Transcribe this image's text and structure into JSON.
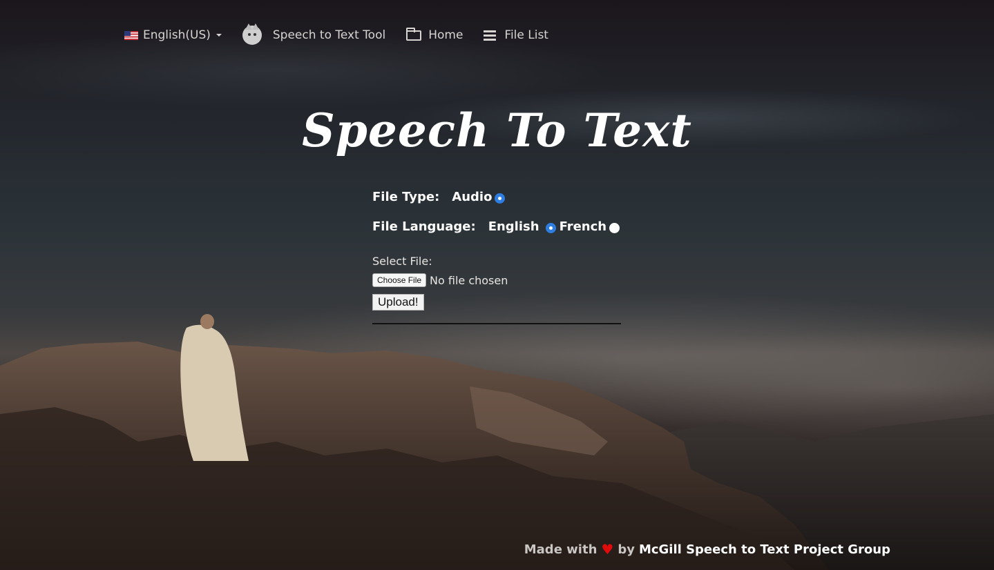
{
  "nav": {
    "language": "English(US)",
    "brand": "Speech to Text Tool",
    "home": "Home",
    "file_list": "File List"
  },
  "main": {
    "title": "Speech To Text",
    "file_type_label": "File Type:",
    "file_type_options": [
      {
        "label": "Audio",
        "checked": true
      }
    ],
    "file_language_label": "File Language:",
    "language_options": [
      {
        "label": "English",
        "checked": true
      },
      {
        "label": "French",
        "checked": false
      }
    ],
    "select_file_label": "Select File:",
    "choose_file_button": "Choose File",
    "no_file_text": "No file chosen",
    "upload_button": "Upload!"
  },
  "footer": {
    "made_with": "Made with",
    "by": "by",
    "group": "McGill Speech to Text Project Group"
  },
  "colors": {
    "accent": "#2e7de0",
    "heart": "#e00b0b"
  }
}
